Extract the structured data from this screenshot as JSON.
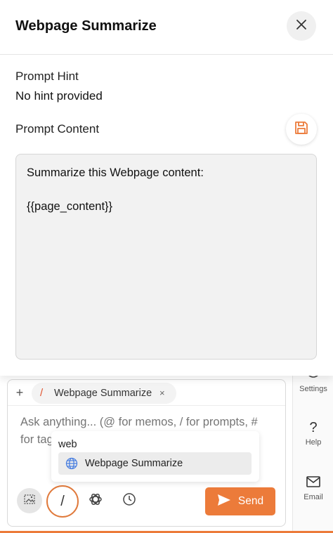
{
  "panel": {
    "title": "Webpage Summarize",
    "close_icon": "close-icon",
    "prompt_hint_label": "Prompt Hint",
    "prompt_hint_value": "No hint provided",
    "prompt_content_label": "Prompt Content",
    "save_icon": "save-icon",
    "content_lines": [
      "Summarize this Webpage content:",
      "{{page_content}}"
    ]
  },
  "rail": {
    "settings_label": "Settings",
    "help_label": "Help",
    "email_label": "Email"
  },
  "chat": {
    "add_label": "+",
    "chip": {
      "slash": "/",
      "label": "Webpage Summarize",
      "remove": "×"
    },
    "input_placeholder": "Ask anything... (@ for memos, / for prompts, # for tags)",
    "slash_label": "/",
    "send_label": "Send"
  },
  "suggestions": {
    "query": "web",
    "items": [
      "Webpage Summarize"
    ]
  },
  "colors": {
    "accent": "#ec7b3a",
    "slash_red": "#e0522d",
    "globe_blue": "#4a7fe0"
  }
}
